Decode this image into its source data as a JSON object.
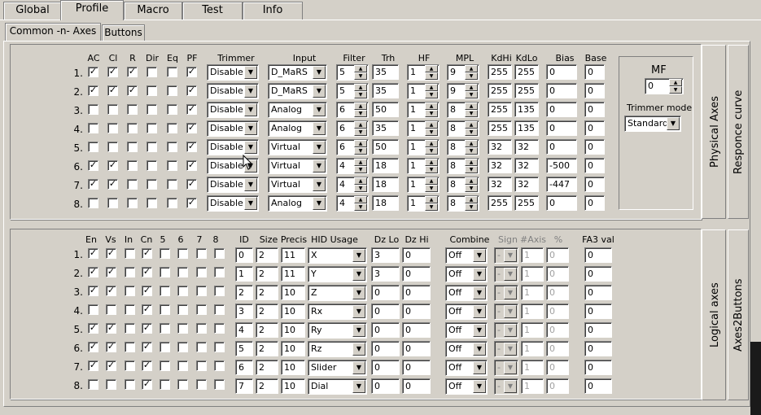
{
  "main_tabs": [
    "Global",
    "Profile",
    "Macro",
    "Test",
    "Info"
  ],
  "sub_tabs": [
    "Common -n- Axes",
    "Buttons"
  ],
  "physical": {
    "headers": [
      "AC",
      "Cl",
      "R",
      "Dir",
      "Eq",
      "PF",
      "Trimmer",
      "Input",
      "Filter",
      "Trh",
      "HF",
      "MPL",
      "KdHi",
      "KdLo",
      "Bias",
      "Base"
    ],
    "rows": [
      {
        "num": "1.",
        "checks": [
          true,
          true,
          true,
          false,
          false,
          true
        ],
        "trimmer": "Disable",
        "input": "D_MaRS",
        "filter": "5",
        "trh": "35",
        "hf": "1",
        "mpl": "9",
        "kdhi": "255",
        "kdlo": "255",
        "bias": "0",
        "base": "0"
      },
      {
        "num": "2.",
        "checks": [
          true,
          true,
          true,
          false,
          false,
          true
        ],
        "trimmer": "Disable",
        "input": "D_MaRS",
        "filter": "5",
        "trh": "35",
        "hf": "1",
        "mpl": "9",
        "kdhi": "255",
        "kdlo": "255",
        "bias": "0",
        "base": "0"
      },
      {
        "num": "3.",
        "checks": [
          false,
          false,
          false,
          false,
          false,
          true
        ],
        "trimmer": "Disable",
        "input": "Analog",
        "filter": "6",
        "trh": "50",
        "hf": "1",
        "mpl": "8",
        "kdhi": "255",
        "kdlo": "135",
        "bias": "0",
        "base": "0"
      },
      {
        "num": "4.",
        "checks": [
          false,
          false,
          false,
          false,
          false,
          true
        ],
        "trimmer": "Disable",
        "input": "Analog",
        "filter": "6",
        "trh": "35",
        "hf": "1",
        "mpl": "8",
        "kdhi": "255",
        "kdlo": "135",
        "bias": "0",
        "base": "0"
      },
      {
        "num": "5.",
        "checks": [
          false,
          false,
          false,
          false,
          false,
          true
        ],
        "trimmer": "Disable",
        "input": "Virtual",
        "filter": "6",
        "trh": "50",
        "hf": "1",
        "mpl": "8",
        "kdhi": "32",
        "kdlo": "32",
        "bias": "0",
        "base": "0"
      },
      {
        "num": "6.",
        "checks": [
          true,
          true,
          false,
          false,
          false,
          true
        ],
        "trimmer": "Disable",
        "input": "Virtual",
        "filter": "4",
        "trh": "18",
        "hf": "1",
        "mpl": "8",
        "kdhi": "32",
        "kdlo": "32",
        "bias": "-500",
        "base": "0"
      },
      {
        "num": "7.",
        "checks": [
          true,
          true,
          false,
          false,
          false,
          true
        ],
        "trimmer": "Disable",
        "input": "Virtual",
        "filter": "4",
        "trh": "18",
        "hf": "1",
        "mpl": "8",
        "kdhi": "32",
        "kdlo": "32",
        "bias": "-447",
        "base": "0"
      },
      {
        "num": "8.",
        "checks": [
          false,
          false,
          false,
          false,
          false,
          true
        ],
        "trimmer": "Disable",
        "input": "Analog",
        "filter": "4",
        "trh": "18",
        "hf": "1",
        "mpl": "8",
        "kdhi": "255",
        "kdlo": "255",
        "bias": "0",
        "base": "0"
      }
    ]
  },
  "mf": {
    "label": "MF",
    "value": "0",
    "trimmer_mode_label": "Trimmer mode",
    "trimmer_mode": "Standard"
  },
  "side_tabs_physical": [
    "Physical Axes",
    "Responce curve"
  ],
  "logical": {
    "headers": [
      "En",
      "Vs",
      "In",
      "Cn",
      "5",
      "6",
      "7",
      "8",
      "ID",
      "Size",
      "Precis",
      "HID Usage",
      "Dz Lo",
      "Dz Hi",
      "Combine",
      "Sign",
      "#Axis",
      "%",
      "FA3 val"
    ],
    "rows": [
      {
        "num": "1.",
        "checks": [
          true,
          true,
          false,
          true,
          false,
          false,
          false,
          false
        ],
        "id": "0",
        "size": "2",
        "precis": "11",
        "usage": "X",
        "dzlo": "3",
        "dzhi": "0",
        "combine": "Off",
        "sign": "-",
        "axis": "1",
        "pct": "0",
        "fa3": "0"
      },
      {
        "num": "2.",
        "checks": [
          true,
          true,
          false,
          true,
          false,
          false,
          false,
          false
        ],
        "id": "1",
        "size": "2",
        "precis": "11",
        "usage": "Y",
        "dzlo": "3",
        "dzhi": "0",
        "combine": "Off",
        "sign": "-",
        "axis": "1",
        "pct": "0",
        "fa3": "0"
      },
      {
        "num": "3.",
        "checks": [
          true,
          true,
          false,
          true,
          false,
          false,
          false,
          false
        ],
        "id": "2",
        "size": "2",
        "precis": "10",
        "usage": "Z",
        "dzlo": "0",
        "dzhi": "0",
        "combine": "Off",
        "sign": "-",
        "axis": "1",
        "pct": "0",
        "fa3": "0"
      },
      {
        "num": "4.",
        "checks": [
          false,
          false,
          false,
          true,
          false,
          false,
          false,
          false
        ],
        "id": "3",
        "size": "2",
        "precis": "10",
        "usage": "Rx",
        "dzlo": "0",
        "dzhi": "0",
        "combine": "Off",
        "sign": "-",
        "axis": "1",
        "pct": "0",
        "fa3": "0"
      },
      {
        "num": "5.",
        "checks": [
          true,
          true,
          false,
          true,
          false,
          false,
          false,
          false
        ],
        "id": "4",
        "size": "2",
        "precis": "10",
        "usage": "Ry",
        "dzlo": "0",
        "dzhi": "0",
        "combine": "Off",
        "sign": "-",
        "axis": "1",
        "pct": "0",
        "fa3": "0"
      },
      {
        "num": "6.",
        "checks": [
          true,
          true,
          false,
          true,
          false,
          false,
          false,
          false
        ],
        "id": "5",
        "size": "2",
        "precis": "10",
        "usage": "Rz",
        "dzlo": "0",
        "dzhi": "0",
        "combine": "Off",
        "sign": "-",
        "axis": "1",
        "pct": "0",
        "fa3": "0"
      },
      {
        "num": "7.",
        "checks": [
          true,
          true,
          false,
          true,
          false,
          false,
          false,
          false
        ],
        "id": "6",
        "size": "2",
        "precis": "10",
        "usage": "Slider",
        "dzlo": "0",
        "dzhi": "0",
        "combine": "Off",
        "sign": "-",
        "axis": "1",
        "pct": "0",
        "fa3": "0"
      },
      {
        "num": "8.",
        "checks": [
          false,
          false,
          false,
          true,
          false,
          false,
          false,
          false
        ],
        "id": "7",
        "size": "2",
        "precis": "10",
        "usage": "Dial",
        "dzlo": "0",
        "dzhi": "0",
        "combine": "Off",
        "sign": "-",
        "axis": "1",
        "pct": "0",
        "fa3": "0"
      }
    ]
  },
  "side_tabs_logical": [
    "Logical axes",
    "Axes2Buttons"
  ]
}
